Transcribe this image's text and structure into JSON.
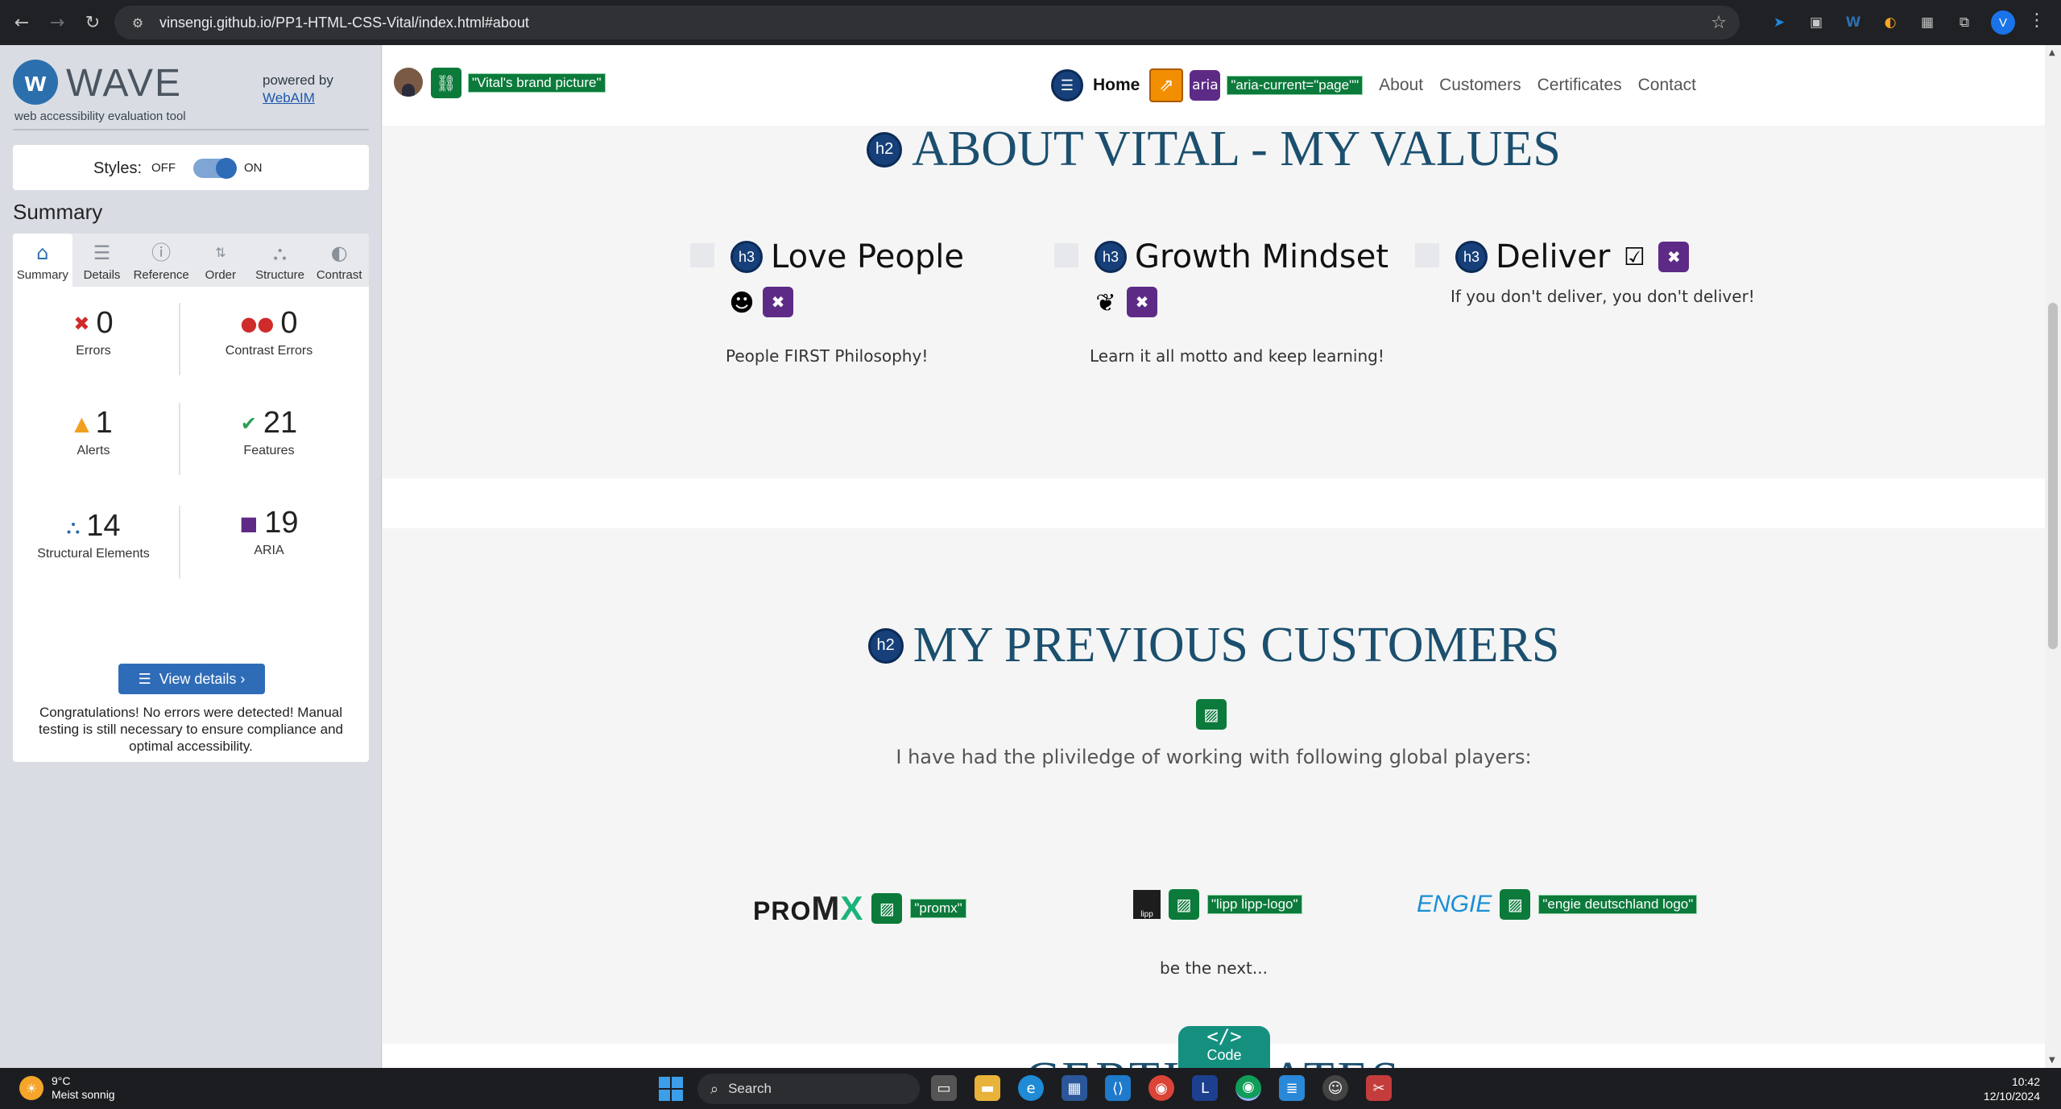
{
  "browser": {
    "url": "vinsengi.github.io/PP1-HTML-CSS-Vital/index.html#about",
    "profile_initial": "V"
  },
  "wave": {
    "logo_text": "WAVE",
    "tagline": "web accessibility evaluation tool",
    "powered_by": "powered by",
    "webaim": "WebAIM",
    "styles_label": "Styles:",
    "styles_off": "OFF",
    "styles_on": "ON",
    "summary_title": "Summary",
    "tabs": [
      {
        "label": "Summary",
        "icon": "home-icon"
      },
      {
        "label": "Details",
        "icon": "list-icon"
      },
      {
        "label": "Reference",
        "icon": "info-icon"
      },
      {
        "label": "Order",
        "icon": "order-icon"
      },
      {
        "label": "Structure",
        "icon": "structure-icon"
      },
      {
        "label": "Contrast",
        "icon": "contrast-icon"
      }
    ],
    "stats": {
      "errors": {
        "value": "0",
        "label": "Errors"
      },
      "contrast_errors": {
        "value": "0",
        "label": "Contrast Errors"
      },
      "alerts": {
        "value": "1",
        "label": "Alerts"
      },
      "features": {
        "value": "21",
        "label": "Features"
      },
      "structural": {
        "value": "14",
        "label": "Structural Elements"
      },
      "aria": {
        "value": "19",
        "label": "ARIA"
      }
    },
    "view_details": "View details ›",
    "congrats": "Congratulations! No errors were detected! Manual testing is still necessary to ensure compliance and optimal accessibility."
  },
  "page": {
    "brand_alt": "\"Vital's brand picture\"",
    "nav": {
      "home": "Home",
      "aria_label": "aria",
      "aria_current": "\"aria-current=\"page\"\"",
      "about": "About",
      "customers": "Customers",
      "certificates": "Certificates",
      "contact": "Contact"
    },
    "values_title": "ABOUT VITAL - MY VALUES",
    "h2_badge": "h2",
    "h3_badge": "h3",
    "values": [
      {
        "title": "Love People",
        "desc": "People FIRST Philosophy!"
      },
      {
        "title": "Growth Mindset",
        "desc": "Learn it all motto and keep learning!"
      },
      {
        "title": "Deliver",
        "desc": "If you don't deliver, you don't deliver!"
      }
    ],
    "customers_title": "MY PREVIOUS CUSTOMERS",
    "customers_sub": "I have had the pliviledge of working with following global players:",
    "logos": [
      {
        "name": "proMX",
        "alt": "\"promx\""
      },
      {
        "name": "lipp",
        "alt": "\"lipp lipp-logo\""
      },
      {
        "name": "ENGIE",
        "alt": "\"engie deutschland logo\""
      }
    ],
    "be_next": "be the next...",
    "cert_title": "CERTIFICATES",
    "code_label": "Code",
    "code_icon": "</>"
  },
  "taskbar": {
    "temp": "9°C",
    "weather": "Meist sonnig",
    "search": "Search",
    "time": "10:42",
    "date": "12/10/2024"
  }
}
